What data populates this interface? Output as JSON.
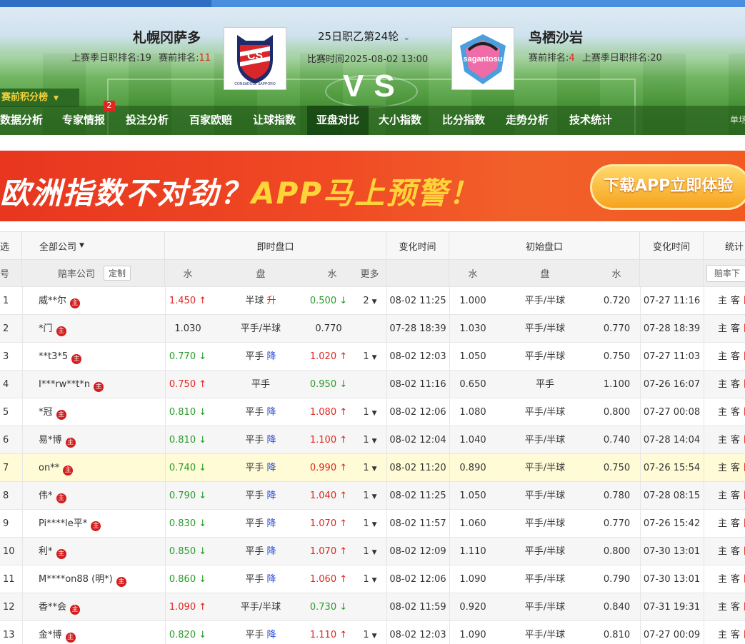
{
  "match": {
    "home": {
      "name": "札幌冈萨多",
      "last_season_label": "上赛季日职排名:",
      "last_season_rank": "19",
      "pre_rank_label": "赛前排名:",
      "pre_rank": "11"
    },
    "away": {
      "name": "鸟栖沙岩",
      "pre_rank_label": "赛前排名:",
      "pre_rank": "4",
      "last_season_label": "上赛季日职排名:",
      "last_season_rank": "20"
    },
    "round": "25日职乙第24轮",
    "time": "比赛时间2025-08-02 13:00",
    "vs": "VS",
    "home_logo_text": "CS",
    "home_logo_caption": "CONSADOLE SAPPORO",
    "away_logo_text": "sagantosu"
  },
  "pre_rank_tab": "赛前积分榜",
  "nav": {
    "items": [
      "数据分析",
      "专家情报",
      "投注分析",
      "百家欧赔",
      "让球指数",
      "亚盘对比",
      "大小指数",
      "比分指数",
      "走势分析",
      "技术统计",
      "单场"
    ],
    "badge": "2",
    "active": "亚盘对比"
  },
  "banner": {
    "text_a": "欧洲指数不对劲？",
    "text_b": "APP马上预警！",
    "button": "下载APP立即体验"
  },
  "table": {
    "h1": {
      "select": "选",
      "company_filter": "全部公司",
      "live": "即时盘口",
      "change_time": "变化时间",
      "initial": "初始盘口",
      "change_time2": "变化时间",
      "stats": "统计"
    },
    "h2": {
      "num": "号",
      "company": "赔率公司",
      "customize": "定制",
      "water1": "水",
      "line": "盘",
      "water2": "水",
      "more": "更多",
      "water3": "水",
      "line2": "盘",
      "water4": "水",
      "sort": "赔率下"
    },
    "home_label": "主",
    "away_label": "客",
    "extra_label": "同",
    "rows": [
      {
        "num": "1",
        "company": "威**尔",
        "w1": "1.450",
        "w1d": "up",
        "line": "半球",
        "chg": "升",
        "w2": "0.500",
        "w2d": "dn",
        "more": "2",
        "time": "08-02 11:25",
        "iw1": "1.000",
        "iline": "平手/半球",
        "iw2": "0.720",
        "itime": "07-27 11:16"
      },
      {
        "num": "2",
        "company": "*门",
        "w1": "1.030",
        "w1d": "",
        "line": "平手/半球",
        "chg": "",
        "w2": "0.770",
        "w2d": "",
        "more": "",
        "time": "07-28 18:39",
        "iw1": "1.030",
        "iline": "平手/半球",
        "iw2": "0.770",
        "itime": "07-28 18:39"
      },
      {
        "num": "3",
        "company": "**t3*5",
        "w1": "0.770",
        "w1d": "dn",
        "line": "平手",
        "chg": "降",
        "w2": "1.020",
        "w2d": "up",
        "more": "1",
        "time": "08-02 12:03",
        "iw1": "1.050",
        "iline": "平手/半球",
        "iw2": "0.750",
        "itime": "07-27 11:03"
      },
      {
        "num": "4",
        "company": "I***rw**t*n",
        "w1": "0.750",
        "w1d": "up",
        "line": "平手",
        "chg": "",
        "w2": "0.950",
        "w2d": "dn",
        "more": "",
        "time": "08-02 11:16",
        "iw1": "0.650",
        "iline": "平手",
        "iw2": "1.100",
        "itime": "07-26 16:07"
      },
      {
        "num": "5",
        "company": "*冠",
        "w1": "0.810",
        "w1d": "dn",
        "line": "平手",
        "chg": "降",
        "w2": "1.080",
        "w2d": "up",
        "more": "1",
        "time": "08-02 12:06",
        "iw1": "1.080",
        "iline": "平手/半球",
        "iw2": "0.800",
        "itime": "07-27 00:08"
      },
      {
        "num": "6",
        "company": "易*博",
        "w1": "0.810",
        "w1d": "dn",
        "line": "平手",
        "chg": "降",
        "w2": "1.100",
        "w2d": "up",
        "more": "1",
        "time": "08-02 12:04",
        "iw1": "1.040",
        "iline": "平手/半球",
        "iw2": "0.740",
        "itime": "07-28 14:04"
      },
      {
        "num": "7",
        "company": "on**",
        "w1": "0.740",
        "w1d": "dn",
        "line": "平手",
        "chg": "降",
        "w2": "0.990",
        "w2d": "up",
        "more": "1",
        "time": "08-02 11:20",
        "iw1": "0.890",
        "iline": "平手/半球",
        "iw2": "0.750",
        "itime": "07-26 15:54"
      },
      {
        "num": "8",
        "company": "伟*",
        "w1": "0.790",
        "w1d": "dn",
        "line": "平手",
        "chg": "降",
        "w2": "1.040",
        "w2d": "up",
        "more": "1",
        "time": "08-02 11:25",
        "iw1": "1.050",
        "iline": "平手/半球",
        "iw2": "0.780",
        "itime": "07-28 08:15"
      },
      {
        "num": "9",
        "company": "Pi****le平*",
        "w1": "0.830",
        "w1d": "dn",
        "line": "平手",
        "chg": "降",
        "w2": "1.070",
        "w2d": "up",
        "more": "1",
        "time": "08-02 11:57",
        "iw1": "1.060",
        "iline": "平手/半球",
        "iw2": "0.770",
        "itime": "07-26 15:42"
      },
      {
        "num": "10",
        "company": "利*",
        "w1": "0.850",
        "w1d": "dn",
        "line": "平手",
        "chg": "降",
        "w2": "1.070",
        "w2d": "up",
        "more": "1",
        "time": "08-02 12:09",
        "iw1": "1.110",
        "iline": "平手/半球",
        "iw2": "0.800",
        "itime": "07-30 13:01"
      },
      {
        "num": "11",
        "company": "M****on88 (明*)",
        "w1": "0.860",
        "w1d": "dn",
        "line": "平手",
        "chg": "降",
        "w2": "1.060",
        "w2d": "up",
        "more": "1",
        "time": "08-02 12:06",
        "iw1": "1.090",
        "iline": "平手/半球",
        "iw2": "0.790",
        "itime": "07-30 13:01"
      },
      {
        "num": "12",
        "company": "香**会",
        "w1": "1.090",
        "w1d": "up",
        "line": "平手/半球",
        "chg": "",
        "w2": "0.730",
        "w2d": "dn",
        "more": "",
        "time": "08-02 11:59",
        "iw1": "0.920",
        "iline": "平手/半球",
        "iw2": "0.840",
        "itime": "07-31 19:31"
      },
      {
        "num": "13",
        "company": "金*博",
        "w1": "0.820",
        "w1d": "dn",
        "line": "平手",
        "chg": "降",
        "w2": "1.110",
        "w2d": "up",
        "more": "1",
        "time": "08-02 12:03",
        "iw1": "1.090",
        "iline": "平手/半球",
        "iw2": "0.810",
        "itime": "07-27 00:09"
      }
    ],
    "highlight_row": "7",
    "zhu_icon": "主"
  },
  "colors": {
    "up": "#e0261f",
    "down": "#2a9a2a",
    "line_down": "#2f4fd6",
    "highlight": "#fffbd6"
  }
}
